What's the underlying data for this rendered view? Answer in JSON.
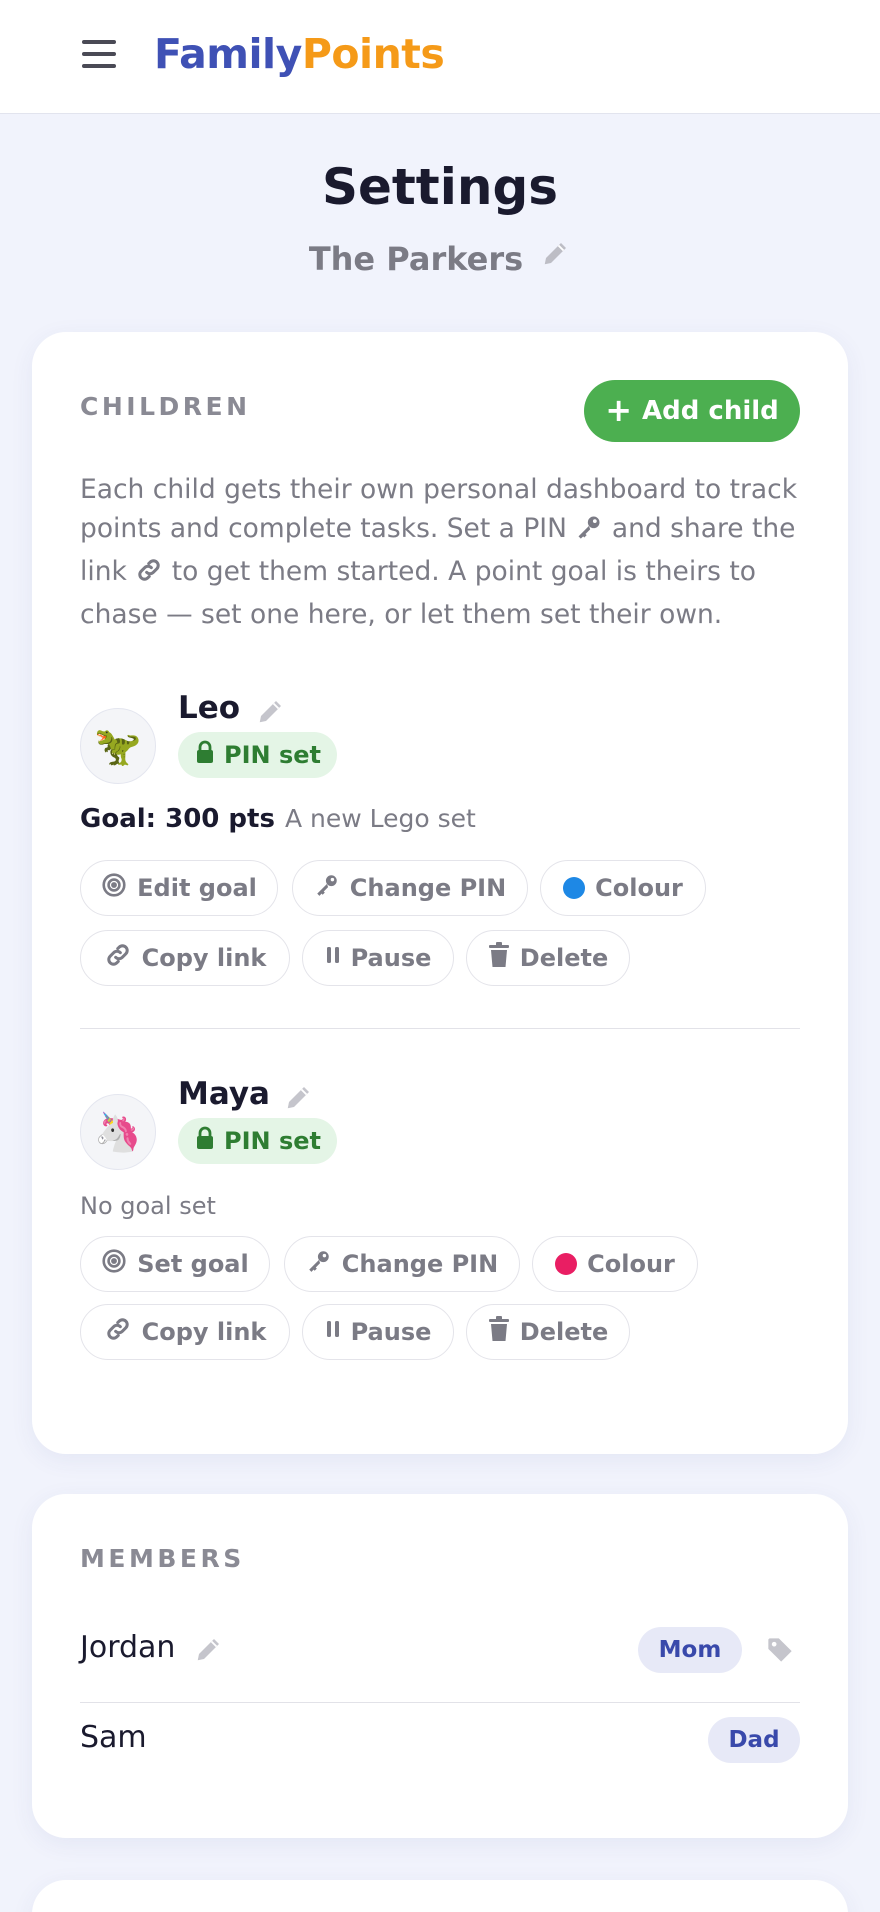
{
  "app": {
    "logo_part1": "Family",
    "logo_part2": "Points"
  },
  "page": {
    "title": "Settings",
    "family_name": "The Parkers"
  },
  "children_section": {
    "label": "CHILDREN",
    "add_button": "Add child",
    "intro_1": "Each child gets their own personal dashboard to track points and complete tasks. Set a PIN",
    "intro_2": "and share the link",
    "intro_3": "to get them started. A point goal is theirs to chase — set one here, or let them set their own."
  },
  "children": [
    {
      "name": "Leo",
      "avatar": "🦖",
      "pin_status": "PIN set",
      "goal_label": "Goal: 300 pts",
      "goal_desc": "A new Lego set",
      "color": "#1e88e5",
      "actions": {
        "goal": "Edit goal",
        "pin": "Change PIN",
        "colour": "Colour",
        "link": "Copy link",
        "pause": "Pause",
        "delete": "Delete"
      }
    },
    {
      "name": "Maya",
      "avatar": "🦄",
      "pin_status": "PIN set",
      "goal_label": "No goal set",
      "color": "#e91e63",
      "actions": {
        "goal": "Set goal",
        "pin": "Change PIN",
        "colour": "Colour",
        "link": "Copy link",
        "pause": "Pause",
        "delete": "Delete"
      }
    }
  ],
  "members_section": {
    "label": "MEMBERS"
  },
  "members": [
    {
      "name": "Jordan",
      "role": "Mom"
    },
    {
      "name": "Sam",
      "role": "Dad"
    }
  ],
  "icons": [
    "menu-icon",
    "pencil-icon",
    "key-icon",
    "link-icon",
    "lock-icon",
    "target-icon",
    "pause-icon",
    "trash-icon",
    "tag-icon",
    "plus-icon"
  ]
}
